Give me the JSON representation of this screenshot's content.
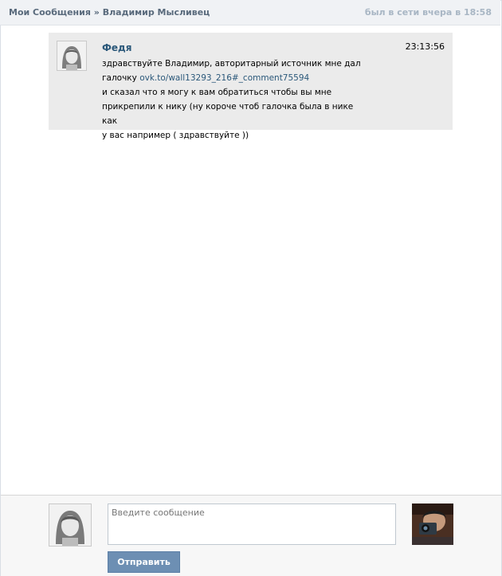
{
  "header": {
    "breadcrumb_root": "Мои Сообщения",
    "breadcrumb_sep": "»",
    "breadcrumb_current": "Владимир Мысливец",
    "last_seen": "был в сети вчера в 18:58"
  },
  "message": {
    "author": "Федя",
    "time": "23:13:56",
    "line1": "здравствуйте Владимир, авторитарный источник мне дал",
    "line2_prefix": "галочку ",
    "link": "ovk.to/wall13293_216#_comment75594",
    "line3": "и сказал что я могу к вам обратиться чтобы вы мне",
    "line4": "прикрепили к нику (ну короче чтоб галочка была в нике как",
    "line5": "у вас например ( здравствуйте ))",
    "avatar_icon": "anime-girl-avatar"
  },
  "composer": {
    "placeholder": "Введите сообщение",
    "value": "",
    "send_label": "Отправить",
    "my_avatar_icon": "anime-girl-avatar",
    "peer_avatar_icon": "man-with-camera-avatar"
  },
  "colors": {
    "accent": "#2b587a",
    "header_bg": "#f0f2f5",
    "message_bg": "#ebebeb",
    "button_bg": "#6d8fb3"
  }
}
